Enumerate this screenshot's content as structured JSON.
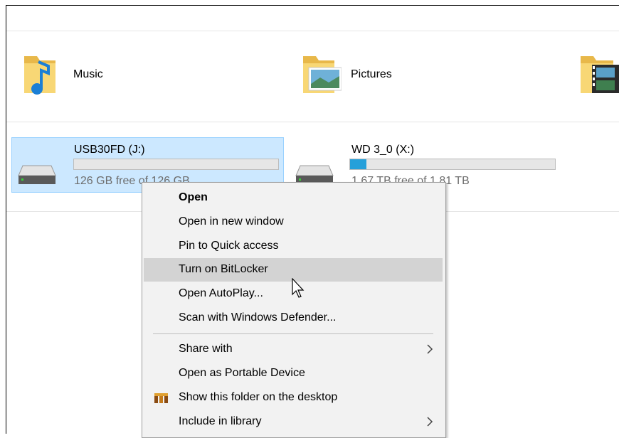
{
  "folders": [
    {
      "label": "Music",
      "icon": "music-folder-icon"
    },
    {
      "label": "Pictures",
      "icon": "pictures-folder-icon"
    },
    {
      "label": "",
      "icon": "videos-folder-icon"
    }
  ],
  "drives": [
    {
      "name": "USB30FD (J:)",
      "free_text": "126 GB free of 126 GB",
      "used_fraction": 0.0,
      "selected": true
    },
    {
      "name": "WD 3_0 (X:)",
      "free_text": "1.67 TB free of 1.81 TB",
      "used_fraction": 0.08,
      "selected": false
    }
  ],
  "context_menu": {
    "items": [
      {
        "label": "Open",
        "bold": true
      },
      {
        "label": "Open in new window"
      },
      {
        "label": "Pin to Quick access"
      },
      {
        "label": "Turn on BitLocker",
        "highlighted": true
      },
      {
        "label": "Open AutoPlay..."
      },
      {
        "label": "Scan with Windows Defender..."
      },
      {
        "label": "Share with",
        "submenu": true
      },
      {
        "label": "Open as Portable Device"
      },
      {
        "label": "Show this folder on the desktop",
        "icon": "nitroshare-icon"
      },
      {
        "label": "Include in library",
        "submenu": true
      }
    ]
  },
  "colors": {
    "selection_bg": "#cce8ff",
    "selection_border": "#99d1ff",
    "drive_fill": "#26a0da",
    "menu_bg": "#f2f2f2",
    "menu_highlight": "#d3d3d3"
  }
}
